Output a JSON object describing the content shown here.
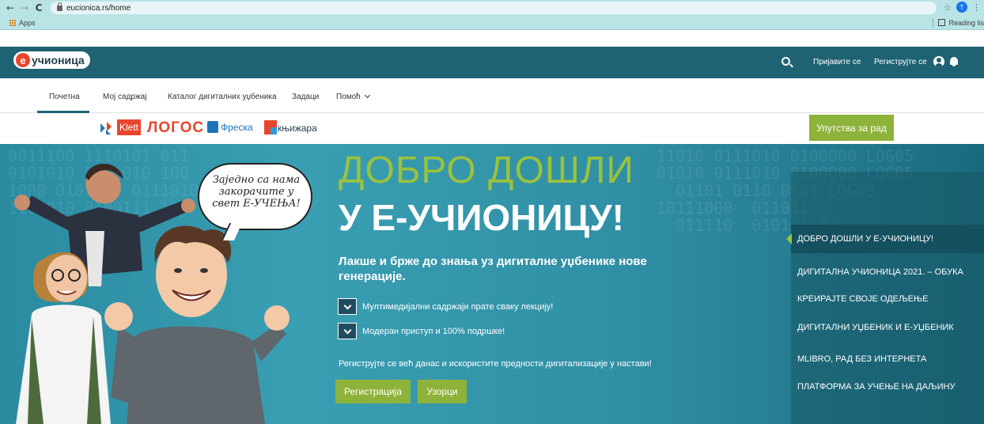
{
  "browser": {
    "back_icon": "←",
    "forward_icon": "→",
    "reload_icon": "C",
    "url": "eucionica.rs/home",
    "star_icon": "☆",
    "profile_initial": "T",
    "menu_icon": "⋮",
    "bookmarks": {
      "apps_label": "Apps",
      "reading_list_label": "Reading lis"
    }
  },
  "header": {
    "logo_e": "e",
    "logo_text": "учионица",
    "login_label": "Пријавите се",
    "register_label": "Региструјте се"
  },
  "nav": {
    "items": [
      {
        "label": "Почетна"
      },
      {
        "label": "Мој садржај"
      },
      {
        "label": "Каталог дигиталних уџбеника"
      },
      {
        "label": "Задаци"
      },
      {
        "label": "Помоћ"
      }
    ]
  },
  "partners": {
    "klett": "Klett",
    "logos": "ЛОГОС",
    "freska": "Фреска",
    "knjizara": "књижара",
    "guide_button": "Упутства за рад"
  },
  "hero": {
    "bubble_text": "Заједно са нама закорачите у свет Е-УЧЕЊА!",
    "title_line1": "ДОБРО ДОШЛИ",
    "title_line2": "У Е-УЧИОНИЦУ!",
    "subtitle": "Лакше и брже до знања уз дигиталне уџбенике нове генерације.",
    "features": [
      "Мултимедијални садржаји прате сваку лекцију!",
      "Модеран приступ и 100% подршке!"
    ],
    "cta_text": "Региструјте се већ данас и искористите предности дигитализације у настави!",
    "register_button": "Регистрација",
    "samples_button": "Узорци"
  },
  "side_menu": {
    "items": [
      "ДОБРО ДОШЛИ У Е-УЧИОНИЦУ!",
      "ДИГИТАЛНА УЧИОНИЦА 2021. – ОБУКА",
      "КРЕИРАЈТЕ СВОЈЕ ОДЕЉЕЊЕ",
      "ДИГИТАЛНИ УЏБЕНИК И Е-УЏБЕНИК",
      "MLIBRO, РАД БЕЗ ИНТЕРНЕТА",
      "ПЛАТФОРМА ЗА УЧЕЊЕ НА ДАЉИНУ"
    ]
  },
  "colors": {
    "header_bg": "#1e6273",
    "accent_green": "#8db33b",
    "title_green": "#9ac23c",
    "brand_red": "#e8452c",
    "freska_blue": "#1d72b8"
  },
  "icons": [
    "back-icon",
    "forward-icon",
    "reload-icon",
    "lock-icon",
    "star-icon",
    "apps-icon",
    "reading-list-icon",
    "search-icon",
    "user-icon",
    "bell-icon",
    "chevron-down-icon"
  ]
}
